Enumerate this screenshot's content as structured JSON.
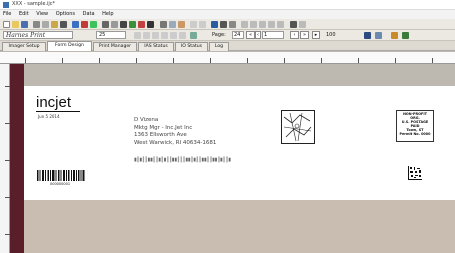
{
  "window": {
    "title": "XXX - sample.ijc*"
  },
  "menu": [
    "File",
    "Edit",
    "View",
    "Options",
    "Data",
    "Help"
  ],
  "fontbar": {
    "font_name": "Harnes Print",
    "font_size": "25",
    "page_label": "Page:",
    "page_current": "24",
    "page_box": "1",
    "zoom": "100"
  },
  "tabs": [
    "Imager Setup",
    "Form Design",
    "Print Manager",
    "IAS Status",
    "IO Status",
    "Log"
  ],
  "active_tab": "Form Design",
  "label": {
    "logo": "incjet",
    "date": "Jun 5 2014",
    "address_lines": [
      "D Vizena",
      "Mktg Mgr - Inc.Jet Inc",
      "1363 Ellsworth Ave",
      "West Warwick, RI 40634-1681"
    ],
    "postal_barcode": "▮║▮║║▮▮║║▮║▮║║▮▮║║║▮▮║▮║║▮▮║║▮▮║▮║║▮",
    "indicia": [
      "NON-PROFIT",
      "ORG.",
      "U.S. POSTAGE",
      "PAID",
      "Town, ST",
      "Permit No. 0000"
    ],
    "barcode_number": "000000001"
  }
}
